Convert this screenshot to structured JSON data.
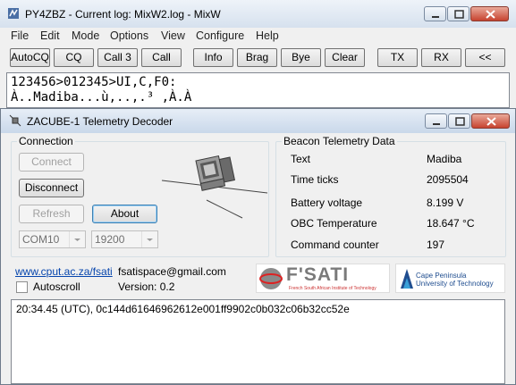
{
  "mixw": {
    "title": "PY4ZBZ - Current log: MixW2.log - MixW",
    "menu": [
      "File",
      "Edit",
      "Mode",
      "Options",
      "View",
      "Configure",
      "Help"
    ],
    "toolbar": [
      "AutoCQ",
      "CQ",
      "Call 3",
      "Call",
      "Info",
      "Brag",
      "Bye",
      "Clear",
      "TX",
      "RX",
      "<<"
    ],
    "rx_lines": [
      "123456>012345>UI,C,F0:",
      "À..Madiba...ù,..,.³ ,À.À"
    ]
  },
  "decoder": {
    "title": "ZACUBE-1 Telemetry Decoder",
    "connection": {
      "group_title": "Connection",
      "connect": "Connect",
      "disconnect": "Disconnect",
      "refresh": "Refresh",
      "about": "About",
      "port": "COM10",
      "baud": "19200"
    },
    "telemetry": {
      "group_title": "Beacon Telemetry Data",
      "rows": [
        {
          "label": "Text",
          "value": "Madiba"
        },
        {
          "label": "Time ticks",
          "value": "2095504"
        },
        {
          "label": "Battery voltage",
          "value": "8.199 V"
        },
        {
          "label": "OBC Temperature",
          "value": "18.647 °C"
        },
        {
          "label": "Command counter",
          "value": "197"
        }
      ]
    },
    "link": "www.cput.ac.za/fsati",
    "email": "fsatispace@gmail.com",
    "autoscroll": "Autoscroll",
    "version": "Version: 0.2",
    "fsati_logo": "F'SATI",
    "fsati_sub": "French South African Institute of Technology",
    "cput_line1": "Cape Peninsula",
    "cput_line2": "University of Technology",
    "log_line": "20:34.45 (UTC), 0c144d61646962612e001ff9902c0b032c06b32cc52e"
  },
  "colors": {
    "accent_blue": "#0645ad",
    "close_red": "#c7432f"
  }
}
